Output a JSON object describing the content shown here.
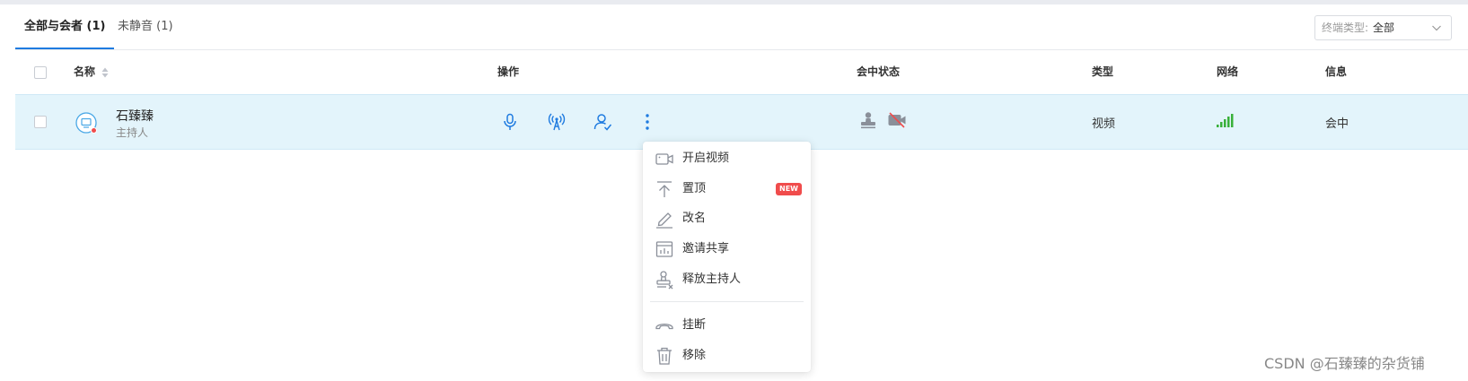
{
  "tabs": [
    {
      "label": "全部与会者 (1)",
      "active": true
    },
    {
      "label": "未静音 (1)",
      "active": false
    }
  ],
  "terminal_filter": {
    "label": "终端类型:",
    "value": "全部"
  },
  "table": {
    "columns": {
      "name": "名称",
      "actions": "操作",
      "status": "会中状态",
      "type": "类型",
      "network": "网络",
      "info": "信息"
    },
    "rows": [
      {
        "name": "石臻臻",
        "role": "主持人",
        "type": "视频",
        "info": "会中",
        "action_icons": [
          "microphone-icon",
          "broadcast-tower-icon",
          "user-check-icon",
          "more-vertical-icon"
        ],
        "status_icons": [
          "host-stamp-icon",
          "camera-off-icon"
        ],
        "network_signal": "strong"
      }
    ]
  },
  "context_menu": {
    "items": [
      {
        "label": "开启视频",
        "icon": "video-camera-icon"
      },
      {
        "label": "置顶",
        "icon": "pin-top-icon",
        "badge": "NEW"
      },
      {
        "label": "改名",
        "icon": "pencil-icon"
      },
      {
        "label": "邀请共享",
        "icon": "share-screen-icon"
      },
      {
        "label": "释放主持人",
        "icon": "release-host-icon"
      },
      {
        "label": "挂断",
        "icon": "hang-up-icon"
      },
      {
        "label": "移除",
        "icon": "trash-icon"
      }
    ]
  },
  "colors": {
    "accent": "#1f7be0",
    "row_highlight": "#e3f4fb",
    "signal_green": "#38b03a",
    "badge_red": "#f04c4c",
    "status_dot": "#f04c4c"
  },
  "watermark": "CSDN @石臻臻的杂货铺"
}
